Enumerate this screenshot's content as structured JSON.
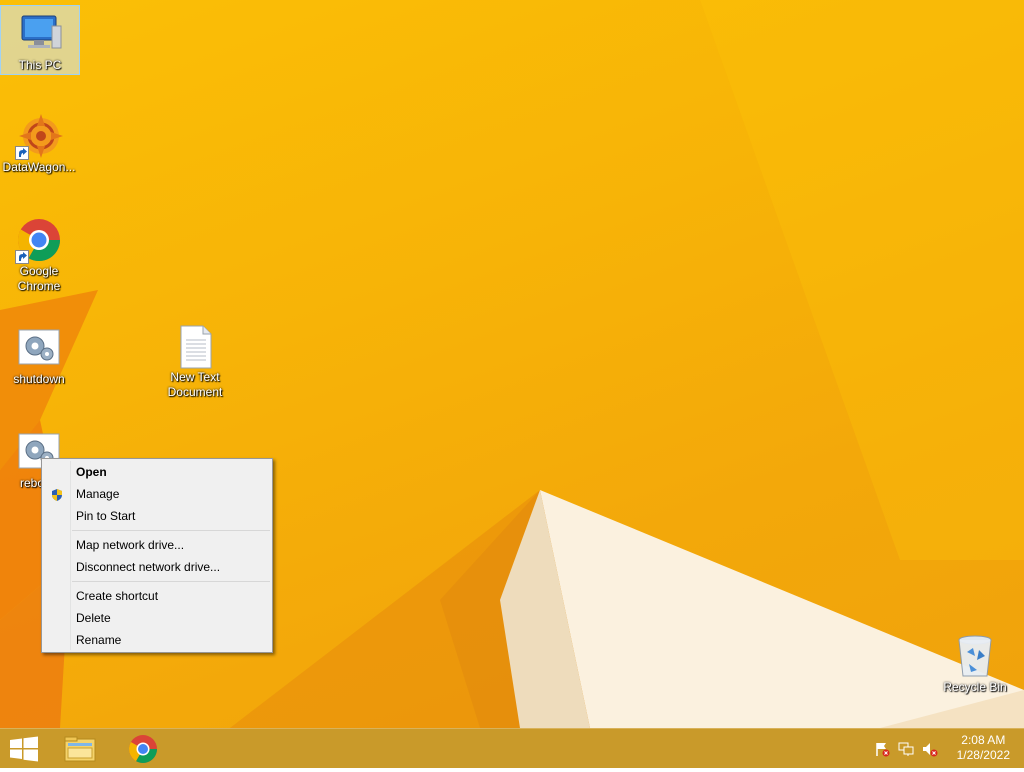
{
  "desktop": {
    "icons": [
      {
        "label": "This PC",
        "icon": "computer-icon"
      },
      {
        "label": "DataWagon...",
        "icon": "datawagon-icon"
      },
      {
        "label": "Google Chrome",
        "icon": "chrome-icon"
      },
      {
        "label": "shutdown",
        "icon": "script-gear-icon"
      },
      {
        "label": "rebo",
        "icon": "script-gear-icon"
      },
      {
        "label": "New Text Document",
        "icon": "text-document-icon"
      },
      {
        "label": "Recycle Bin",
        "icon": "recycle-bin-icon"
      }
    ]
  },
  "context_menu": {
    "items": [
      {
        "label": "Open",
        "bold": true
      },
      {
        "label": "Manage",
        "icon": "uac-shield-icon"
      },
      {
        "label": "Pin to Start"
      },
      {
        "label": "Map network drive..."
      },
      {
        "label": "Disconnect network drive..."
      },
      {
        "label": "Create shortcut"
      },
      {
        "label": "Delete"
      },
      {
        "label": "Rename"
      }
    ]
  },
  "taskbar": {
    "start": "windows-logo-icon",
    "pinned": [
      "file-explorer-icon",
      "chrome-icon"
    ],
    "tray": [
      "action-center-flag-icon",
      "network-icon",
      "volume-muted-icon"
    ],
    "time": "2:08 AM",
    "date": "1/28/2022"
  },
  "colors": {
    "wallpaper": "#f7b307",
    "taskbar": "#c99a2a",
    "menu_bg": "#f0f0f0"
  }
}
